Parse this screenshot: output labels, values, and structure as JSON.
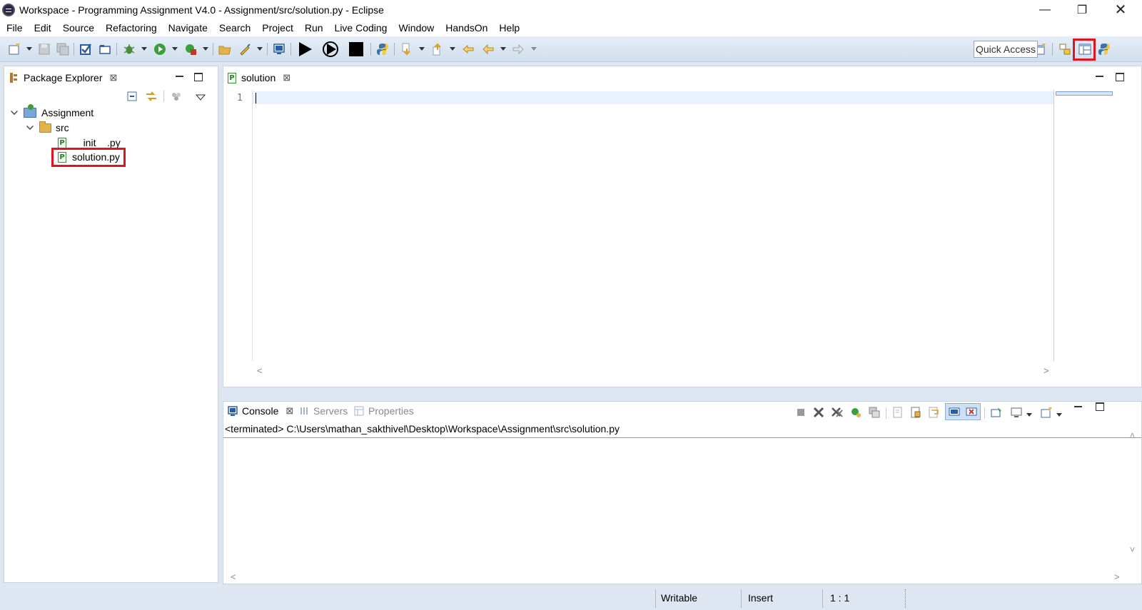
{
  "window": {
    "title": "Workspace - Programming Assignment V4.0 - Assignment/src/solution.py - Eclipse",
    "minimize_icon": "minimize-icon",
    "restore_icon": "restore-icon",
    "close_icon": "close-icon"
  },
  "menu": [
    "File",
    "Edit",
    "Source",
    "Refactoring",
    "Navigate",
    "Search",
    "Project",
    "Run",
    "Live Coding",
    "Window",
    "HandsOn",
    "Help"
  ],
  "toolbar": {
    "quick_access": "Quick Access"
  },
  "package_explorer": {
    "tab_label": "Package Explorer",
    "close_glyph": "⊠",
    "tree": {
      "project": "Assignment",
      "folder": "src",
      "files": [
        "__init__.py",
        "solution.py"
      ]
    },
    "highlighted_file": "solution.py"
  },
  "editor": {
    "tab_label": "solution",
    "close_glyph": "⊠",
    "line_numbers": [
      "1"
    ]
  },
  "console": {
    "tabs": [
      "Console",
      "Servers",
      "Properties"
    ],
    "close_glyph": "⊠",
    "path": "<terminated> C:\\Users\\mathan_sakthivel\\Desktop\\Workspace\\Assignment\\src\\solution.py"
  },
  "status_bar": {
    "writable": "Writable",
    "insert_mode": "Insert",
    "position": "1 : 1"
  },
  "colors": {
    "highlight_box": "#e0141e",
    "chrome_bg": "#dde6f1",
    "current_line": "#e8f2fe"
  }
}
